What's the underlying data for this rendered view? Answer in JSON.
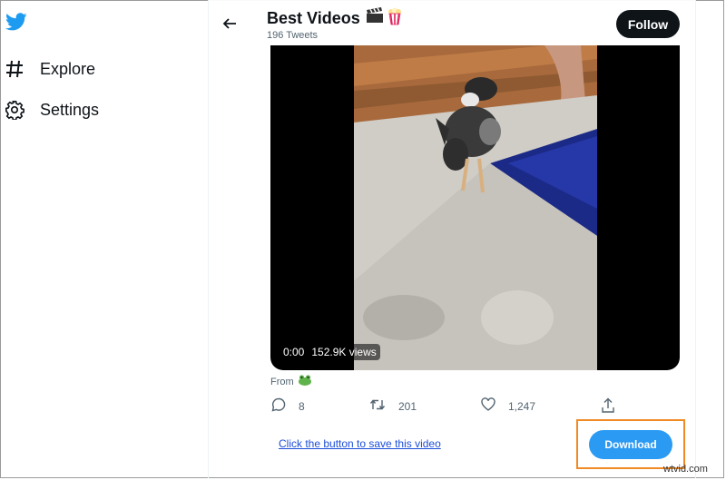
{
  "sidebar": {
    "logo": "twitter-bird-icon",
    "items": [
      {
        "label": "Explore",
        "icon": "hashtag-icon"
      },
      {
        "label": "Settings",
        "icon": "gear-icon"
      }
    ]
  },
  "header": {
    "title": "Best Videos",
    "subtitle": "196 Tweets",
    "follow_label": "Follow"
  },
  "video": {
    "time": "0:00",
    "views": "152.9K views"
  },
  "tweet": {
    "from_label": "From"
  },
  "actions": {
    "replies": "8",
    "retweets": "201",
    "likes": "1,247"
  },
  "download": {
    "link_text": "Click the button to save this video",
    "button_label": "Download"
  },
  "watermark": "wtvid.com",
  "colors": {
    "twitter_blue": "#1d9bf0",
    "download_blue": "#2b9af3",
    "highlight_orange": "#f08a24"
  }
}
